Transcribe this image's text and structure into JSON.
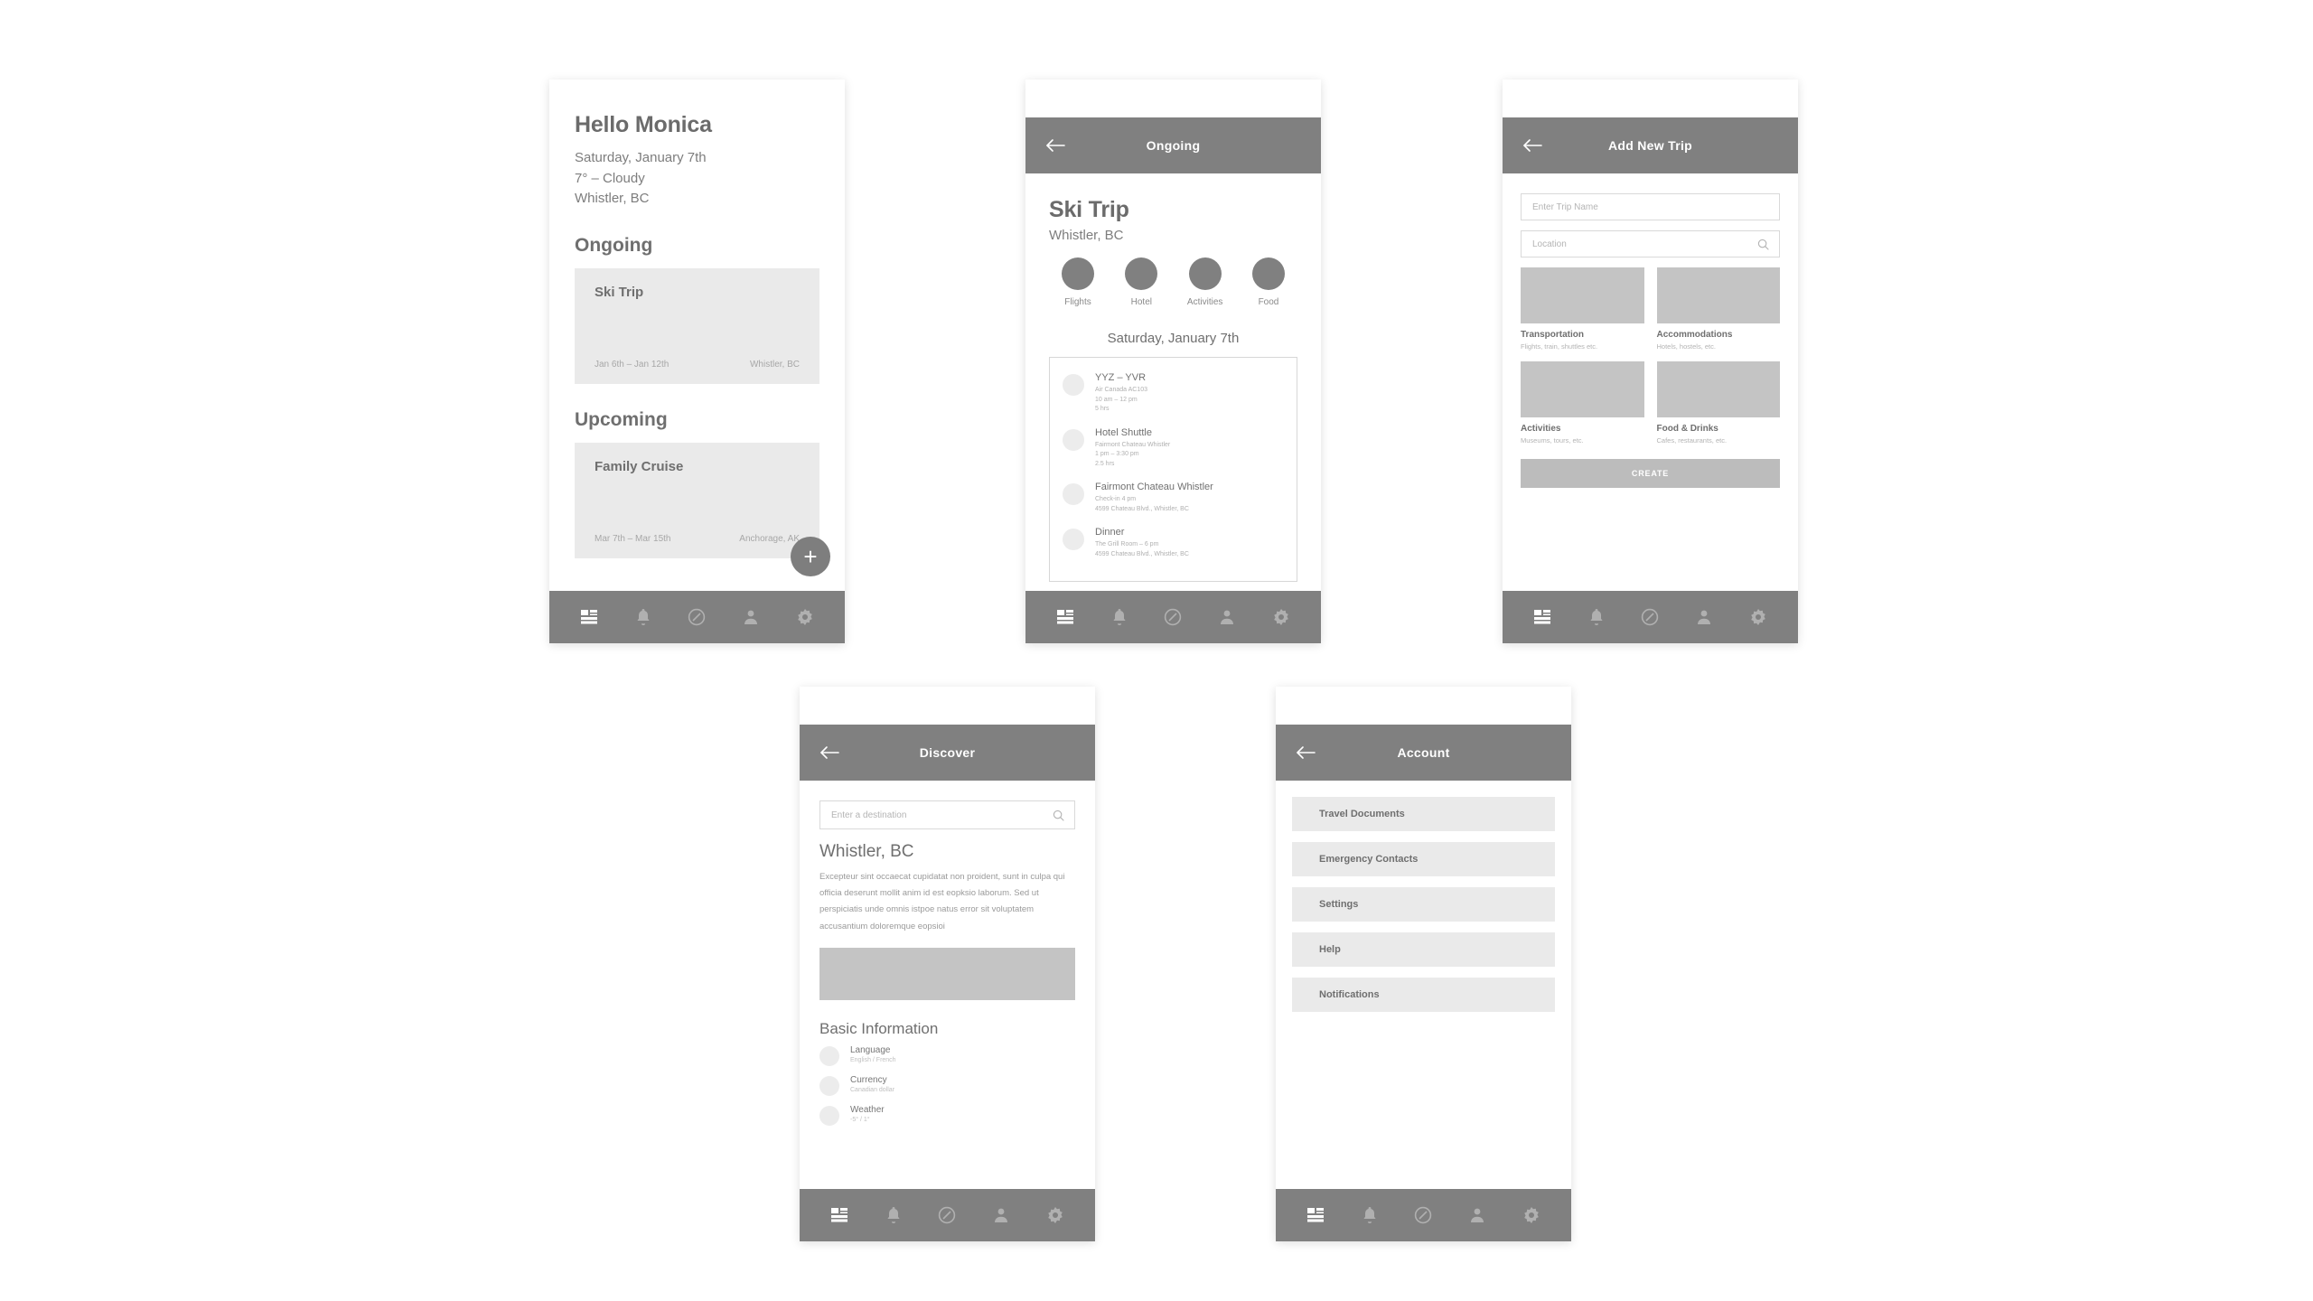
{
  "nav": {
    "items": [
      {
        "name": "dashboard",
        "label": "Dashboard",
        "active": true
      },
      {
        "name": "notifications",
        "label": "Notifications",
        "active": false
      },
      {
        "name": "discover",
        "label": "Discover",
        "active": false
      },
      {
        "name": "account",
        "label": "Account",
        "active": false
      },
      {
        "name": "settings",
        "label": "Settings",
        "active": false
      }
    ]
  },
  "colors": {
    "appbar": "#808080",
    "card": "#eaeaea",
    "placeholder": "#c4c4c4",
    "text_dark": "#6f6f6f",
    "text_muted": "#b0b0b0"
  },
  "home": {
    "greeting": "Hello Monica",
    "date": "Saturday, January 7th",
    "weather": "7° – Cloudy",
    "location": "Whistler, BC",
    "ongoing_title": "Ongoing",
    "upcoming_title": "Upcoming",
    "fab_label": "+",
    "ongoing_trips": [
      {
        "name": "Ski Trip",
        "dates": "Jan 6th – Jan 12th",
        "place": "Whistler, BC"
      }
    ],
    "upcoming_trips": [
      {
        "name": "Family Cruise",
        "dates": "Mar 7th – Mar 15th",
        "place": "Anchorage, AK"
      }
    ]
  },
  "trip_detail": {
    "appbar_title": "Ongoing",
    "trip_name": "Ski Trip",
    "trip_location": "Whistler, BC",
    "categories": [
      {
        "label": "Flights"
      },
      {
        "label": "Hotel"
      },
      {
        "label": "Activities"
      },
      {
        "label": "Food"
      }
    ],
    "date_heading": "Saturday, January 7th",
    "itinerary": [
      {
        "title": "YYZ – YVR",
        "line1": "Air Canada AC103",
        "line2": "10 am – 12 pm",
        "line3": "5 hrs"
      },
      {
        "title": "Hotel Shuttle",
        "line1": "Fairmont Chateau Whistler",
        "line2": "1 pm – 3:30 pm",
        "line3": "2.5 hrs"
      },
      {
        "title": "Fairmont Chateau Whistler",
        "line1": "Check-in 4 pm",
        "line2": "4599 Chateau Blvd., Whistler, BC",
        "line3": ""
      },
      {
        "title": "Dinner",
        "line1": "The Grill Room – 6 pm",
        "line2": "4599 Chateau Blvd., Whistler, BC",
        "line3": ""
      }
    ]
  },
  "add_trip": {
    "appbar_title": "Add New Trip",
    "trip_name_placeholder": "Enter Trip Name",
    "location_placeholder": "Location",
    "create_label": "CREATE",
    "categories": [
      {
        "title": "Transportation",
        "subtitle": "Flights, train, shuttles etc."
      },
      {
        "title": "Accommodations",
        "subtitle": "Hotels, hostels, etc."
      },
      {
        "title": "Activities",
        "subtitle": "Museums, tours, etc."
      },
      {
        "title": "Food & Drinks",
        "subtitle": "Cafes, restaurants, etc."
      }
    ]
  },
  "discover": {
    "appbar_title": "Discover",
    "search_placeholder": "Enter a destination",
    "heading": "Whistler, BC",
    "body": "Excepteur sint occaecat cupidatat non proident, sunt in culpa qui officia deserunt mollit anim id est eopksio laborum. Sed ut perspiciatis unde omnis istpoe natus error sit voluptatem accusantium doloremque eopsioi",
    "basic_info_title": "Basic Information",
    "basic_info": [
      {
        "title": "Language",
        "value": "English / French"
      },
      {
        "title": "Currency",
        "value": "Canadian dollar"
      },
      {
        "title": "Weather",
        "value": "-5° / 1°"
      }
    ]
  },
  "account": {
    "appbar_title": "Account",
    "menu": [
      {
        "label": "Travel Documents"
      },
      {
        "label": "Emergency Contacts"
      },
      {
        "label": "Settings"
      },
      {
        "label": "Help"
      },
      {
        "label": "Notifications"
      }
    ]
  }
}
